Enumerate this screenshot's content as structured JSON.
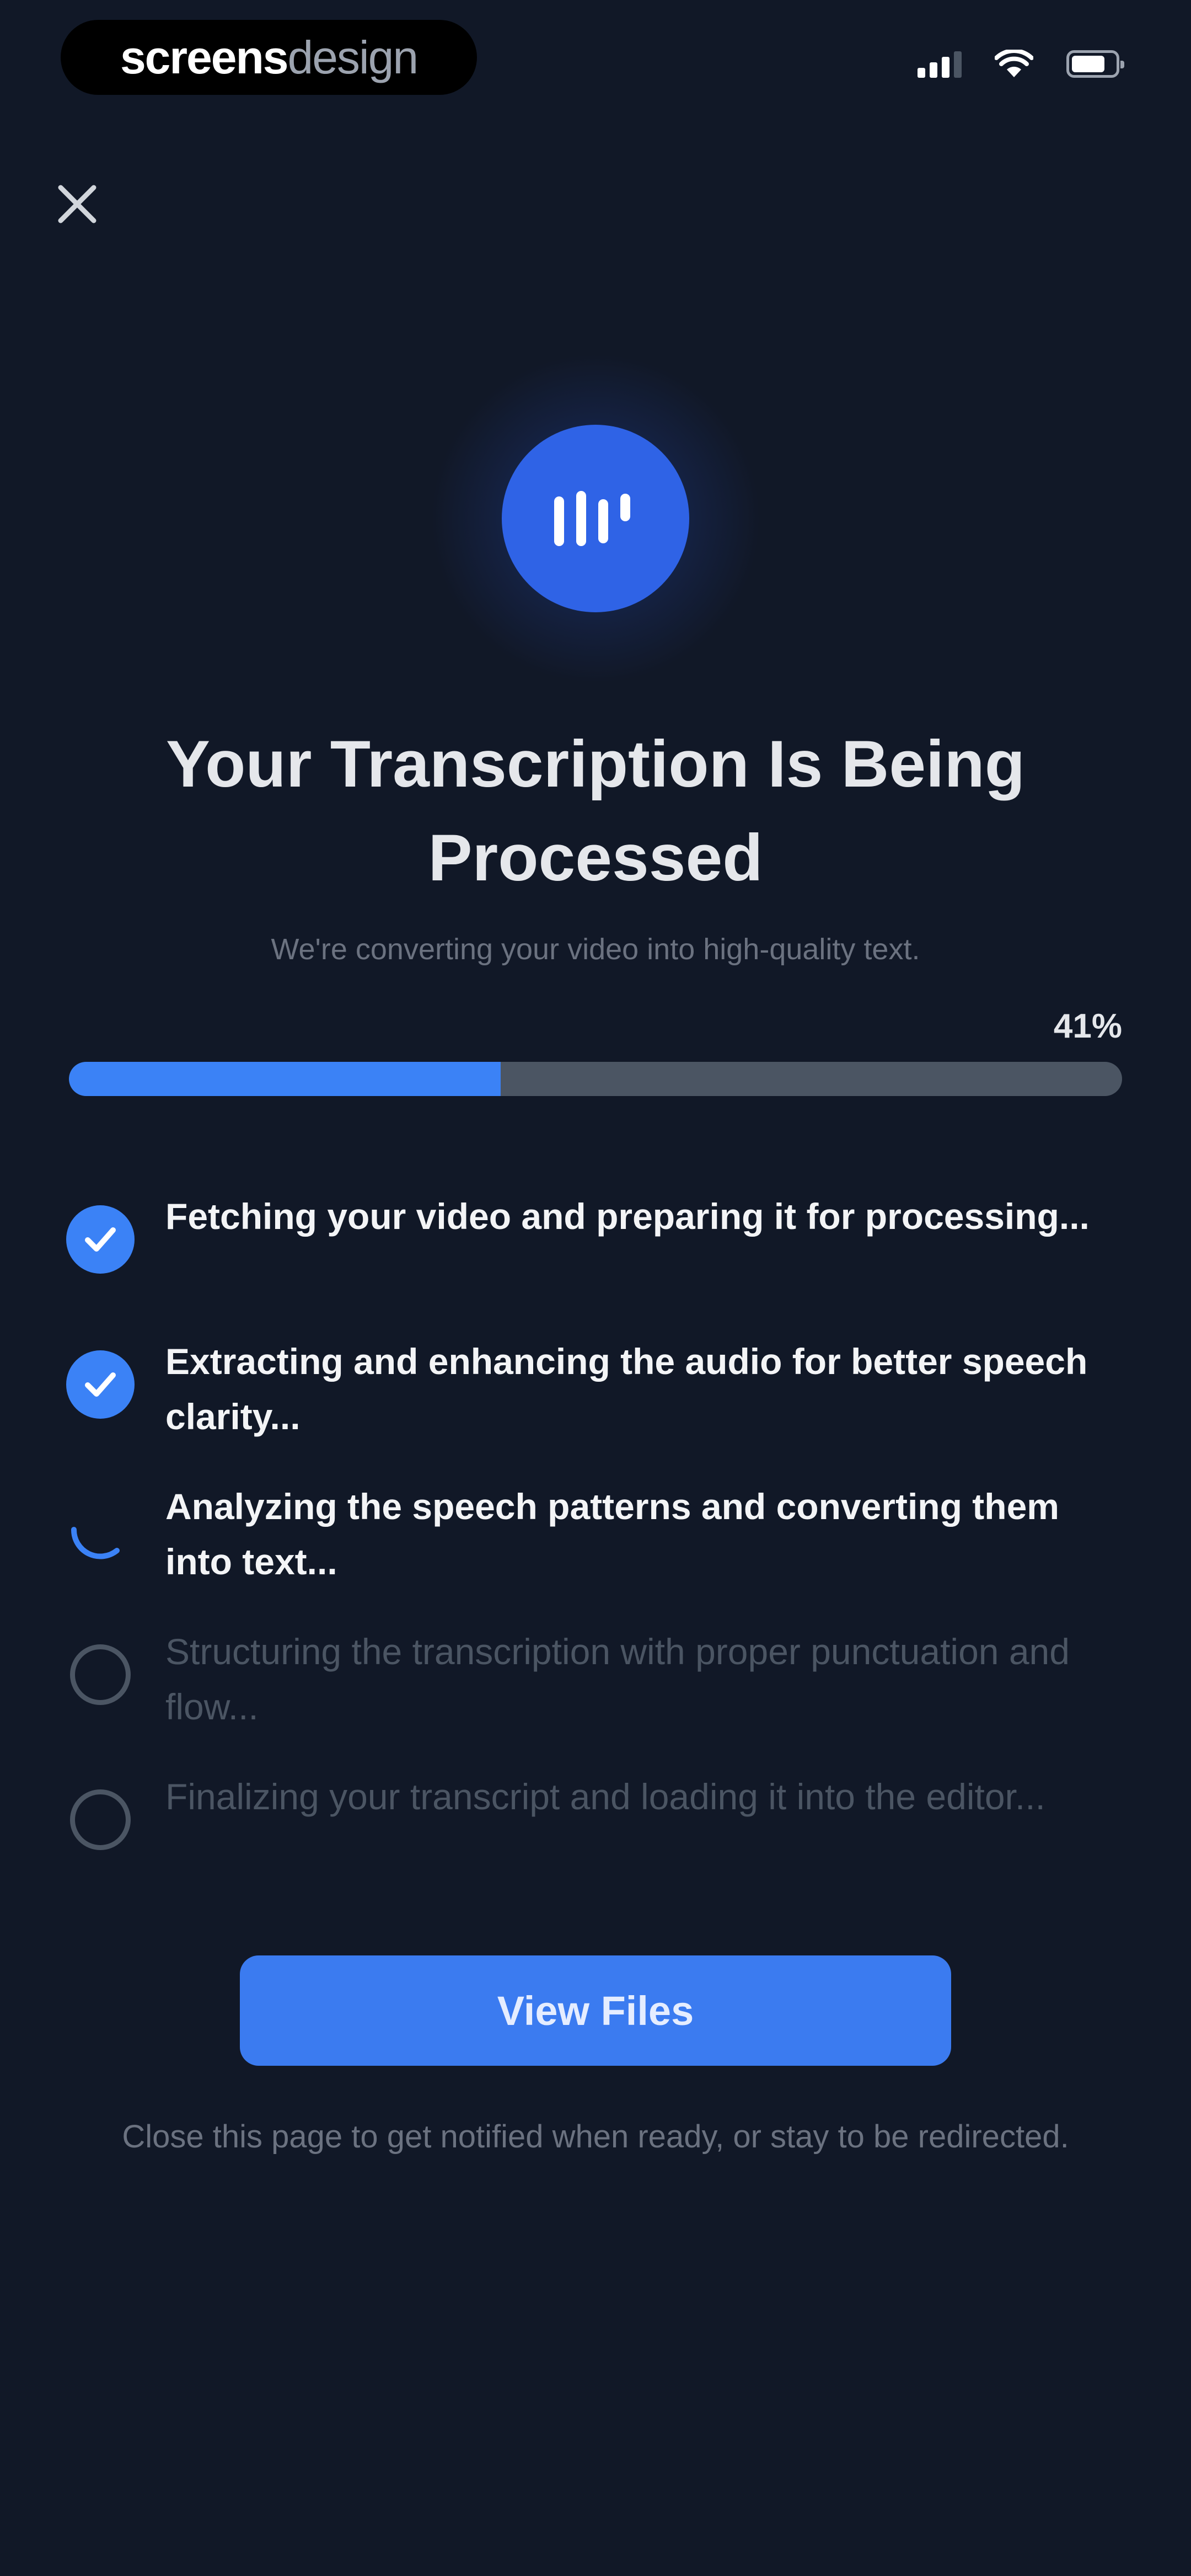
{
  "status_bar": {
    "brand_bold": "screens",
    "brand_light": "design",
    "battery_level": 0.8
  },
  "header": {
    "close_icon": "close-icon"
  },
  "hero": {
    "icon": "audio-waveform-icon",
    "accent_color": "#2f63e6"
  },
  "title": "Your Transcription Is Being Processed",
  "subtitle": "We're converting your video into high-quality text.",
  "progress": {
    "percent_label": "41%",
    "value": 0.41
  },
  "steps": [
    {
      "label": "Fetching your video and preparing it for processing...",
      "status": "done"
    },
    {
      "label": "Extracting and enhancing the audio for better speech clarity...",
      "status": "done"
    },
    {
      "label": "Analyzing the speech patterns and converting them into text...",
      "status": "in-progress"
    },
    {
      "label": "Structuring the transcription with proper punctuation and flow...",
      "status": "pending"
    },
    {
      "label": "Finalizing your transcript and loading it into the editor...",
      "status": "pending"
    }
  ],
  "cta": {
    "label": "View Files"
  },
  "footer_note": "Close this page to get notified when ready, or stay to be redirected.",
  "colors": {
    "background": "#111827",
    "accent": "#3b82f6",
    "track": "#4b5563"
  }
}
